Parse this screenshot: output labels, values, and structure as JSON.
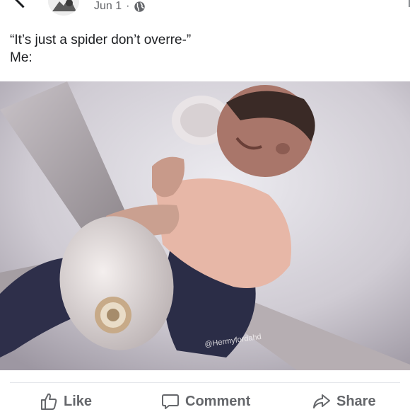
{
  "post": {
    "date": "Jun 1",
    "separator": "·",
    "text_line_1": "“It’s just a spider don’t overre-”",
    "text_line_2": "Me:"
  },
  "photo": {
    "watermark": "@Hermyfordahd"
  },
  "actions": {
    "like_label": "Like",
    "comment_label": "Comment",
    "share_label": "Share"
  },
  "icons": {
    "privacy": "globe-icon",
    "like": "thumbs-up-icon",
    "comment": "speech-bubble-icon",
    "share": "share-arrow-icon"
  },
  "colors": {
    "text": "#1c1e21",
    "secondary_text": "#65676b",
    "divider": "#e4e6eb"
  }
}
